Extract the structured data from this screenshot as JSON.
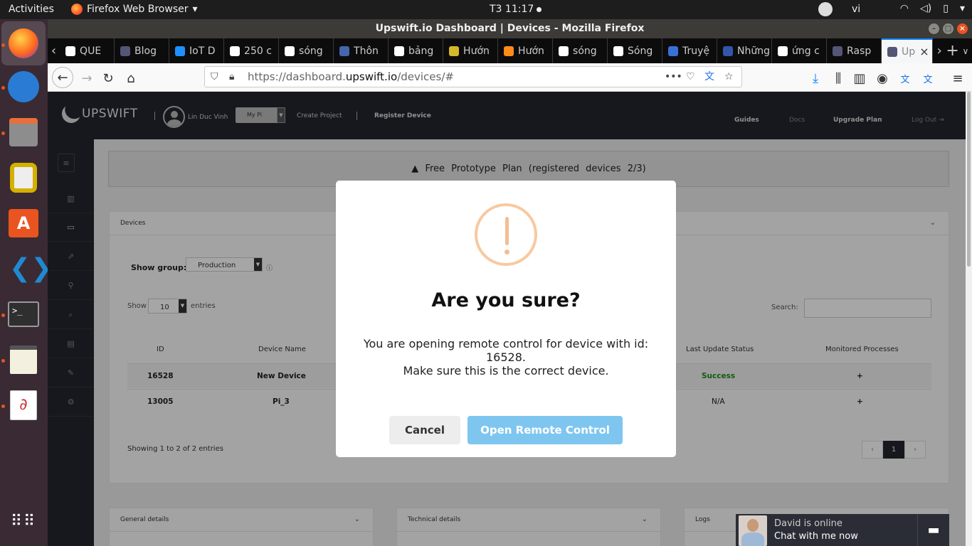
{
  "topbar": {
    "activities": "Activities",
    "app_name": "Firefox Web Browser",
    "clock": "T3 11:17",
    "language": "vi"
  },
  "window": {
    "title": "Upswift.io Dashboard | Devices - Mozilla Firefox"
  },
  "tabs": [
    {
      "label": "QUE",
      "fav_color": "#ffffff"
    },
    {
      "label": "Blog",
      "fav_color": "#555577"
    },
    {
      "label": "IoT D",
      "fav_color": "#1e90ff"
    },
    {
      "label": "250 c",
      "fav_color": "#ffffff"
    },
    {
      "label": "sóng",
      "fav_color": "#ffffff"
    },
    {
      "label": "Thôn",
      "fav_color": "#4466aa"
    },
    {
      "label": "bảng",
      "fav_color": "#ffffff"
    },
    {
      "label": "Hướn",
      "fav_color": "#d4b82a"
    },
    {
      "label": "Hướn",
      "fav_color": "#ff8c1a"
    },
    {
      "label": "sóng",
      "fav_color": "#ffffff"
    },
    {
      "label": "Sóng",
      "fav_color": "#ffffff"
    },
    {
      "label": "Truyệ",
      "fav_color": "#3a6fd6"
    },
    {
      "label": "Những",
      "fav_color": "#3355aa"
    },
    {
      "label": "ứng c",
      "fav_color": "#ffffff"
    },
    {
      "label": "Rasp",
      "fav_color": "#555577"
    },
    {
      "label": "Up",
      "fav_color": "#555577"
    }
  ],
  "urlbar": {
    "prefix": "https://dashboard.",
    "host": "upswift.io",
    "path": "/devices/#"
  },
  "app": {
    "brand": "UPSWIFT",
    "user_name": "Lin Duc Vinh",
    "project_select": "My Pi",
    "create_project": "Create Project",
    "register_device": "Register Device",
    "guides": "Guides",
    "docs": "Docs",
    "upgrade_plan": "Upgrade Plan",
    "log_out": "Log Out"
  },
  "plan_banner": "Free Prototype Plan (registered devices 2/3)",
  "devices_panel": {
    "title": "Devices",
    "show_group_label": "Show group:",
    "show_group_value": "Production",
    "show_label": "Show",
    "entries_value": "10",
    "entries_label": "entries",
    "search_label": "Search:",
    "columns": [
      "ID",
      "Device Name",
      "Last Update Status",
      "Monitored Processes"
    ],
    "rows": [
      {
        "id": "16528",
        "name": "New Device",
        "status": "Success",
        "processes": "+"
      },
      {
        "id": "13005",
        "name": "Pi_3",
        "status": "N/A",
        "processes": "+"
      }
    ],
    "info": "Showing 1 to 2 of 2 entries",
    "pager": {
      "prev": "‹",
      "page": "1",
      "next": "›"
    }
  },
  "bottom_panels": [
    "General details",
    "Technical details",
    "Logs"
  ],
  "modal": {
    "title": "Are you sure?",
    "text_line1": "You are opening remote control for device with id: 16528.",
    "text_line2": "Make sure this is the correct device.",
    "cancel": "Cancel",
    "confirm": "Open Remote Control"
  },
  "chat": {
    "status": "David is online",
    "cta": "Chat with me now"
  }
}
